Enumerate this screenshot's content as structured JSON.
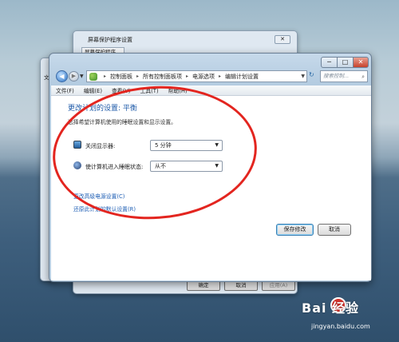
{
  "screen_saver_dialog": {
    "title": "屏幕保护程序设置",
    "tab": "屏幕保护程序",
    "ok": "确定",
    "cancel": "取消",
    "apply": "应用(A)",
    "close": "✕"
  },
  "far_window": {
    "label": "文"
  },
  "window": {
    "min": "─",
    "max": "□",
    "close": "✕",
    "address": [
      "控制面板",
      "所有控制面板项",
      "电源选项",
      "编辑计划设置"
    ],
    "search_placeholder": "搜索控制...",
    "menu": [
      "文件(F)",
      "编辑(E)",
      "查看(V)",
      "工具(T)",
      "帮助(H)"
    ],
    "heading": "更改计划的设置: 平衡",
    "description": "选择希望计算机使用的睡眠设置和显示设置。",
    "settings": [
      {
        "label": "关闭显示器:",
        "value": "5 分钟",
        "icon": "monitor-icon"
      },
      {
        "label": "使计算机进入睡眠状态:",
        "value": "从不",
        "icon": "moon-sleep-icon"
      }
    ],
    "links": [
      "更改高级电源设置(C)",
      "还原此计划的默认设置(R)"
    ],
    "buttons": {
      "save": "保存修改",
      "cancel": "取消"
    }
  },
  "watermark": {
    "brand": "Bai 经验",
    "url": "jingyan.baidu.com"
  },
  "colors": {
    "annotation": "#e3251f",
    "link": "#1f5fb5",
    "heading": "#1e5aa8"
  }
}
